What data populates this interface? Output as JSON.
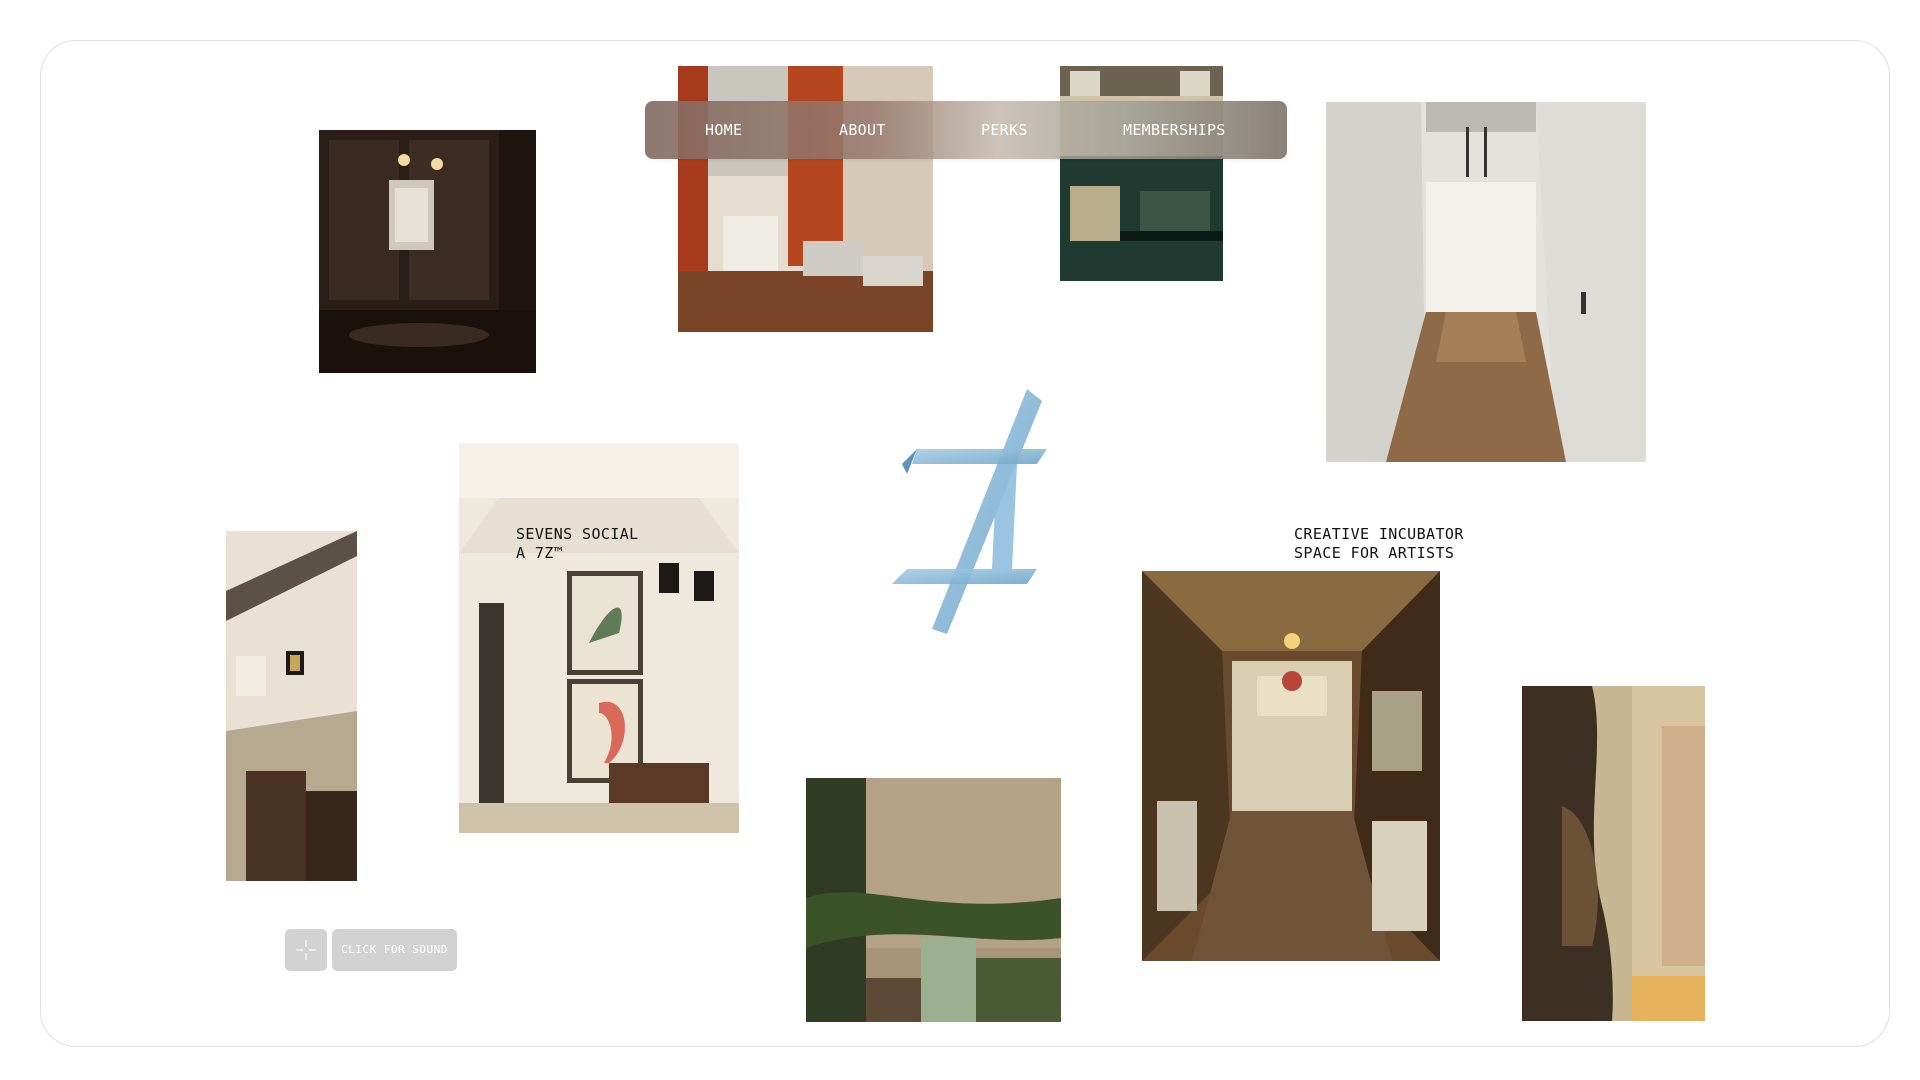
{
  "nav": {
    "items": [
      {
        "label": "HOME"
      },
      {
        "label": "ABOUT"
      },
      {
        "label": "PERKS"
      },
      {
        "label": "MEMBERSHIPS"
      }
    ]
  },
  "captions": {
    "sevens_line1": "SEVENS SOCIAL",
    "sevens_line2": "A 7Z™",
    "incubator_line1": "CREATIVE INCUBATOR",
    "incubator_line2": "SPACE FOR ARTISTS"
  },
  "sound": {
    "button_label": "CLICK FOR SOUND",
    "icon": "crosshair-icon"
  },
  "logo": {
    "icon": "7z-logo",
    "color": "#8ab8d8"
  }
}
